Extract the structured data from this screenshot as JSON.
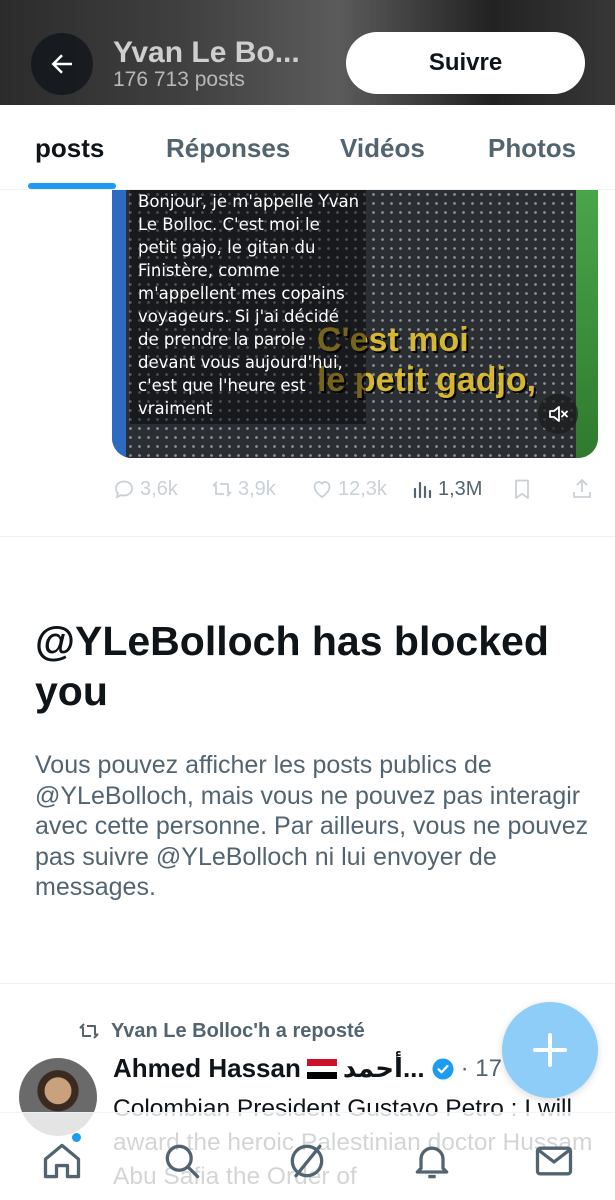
{
  "header": {
    "name": "Yvan Le Bo...",
    "post_count": "176 713 posts",
    "follow_label": "Suivre"
  },
  "tabs": [
    {
      "label": "posts",
      "active": true
    },
    {
      "label": "Réponses",
      "active": false
    },
    {
      "label": "Vidéos",
      "active": false
    },
    {
      "label": "Photos",
      "active": false
    }
  ],
  "video": {
    "caption": "Bonjour, je m'appelle Yvan Le Bolloc. C'est moi le petit gajo, le gitan du Finistère, comme m'appellent mes copains voyageurs. Si j'ai décidé de prendre la parole devant vous aujourd'hui, c'est que l'heure est vraiment",
    "overlay_line1": "C'est moi",
    "overlay_line2": "le petit gadjo,"
  },
  "actions": {
    "replies": "3,6k",
    "reposts": "3,9k",
    "likes": "12,3k",
    "views": "1,3M"
  },
  "blocked": {
    "title": "@YLeBolloch has blocked you",
    "body": "Vous pouvez afficher les posts publics de @YLeBolloch, mais vous ne pouvez pas interagir avec cette personne. Par ailleurs, vous ne pouvez pas suivre @YLeBolloch ni lui envoyer de messages."
  },
  "repost": {
    "label": "Yvan Le Bolloc'h a reposté",
    "author_name": "Ahmed Hassan",
    "author_arabic": "أحمد...",
    "time": "· 17 h",
    "more": "···",
    "text": "Colombian President Gustavo Petro : I will award the heroic Palestinian doctor Hussam Abu Safia the Order of"
  },
  "colors": {
    "accent": "#1d9bf0",
    "fab": "#8ecdf8",
    "secondary_text": "#536471",
    "primary_text": "#0f1419"
  },
  "icons": [
    "back-arrow-icon",
    "reply-icon",
    "repost-icon",
    "like-icon",
    "views-icon",
    "bookmark-icon",
    "share-icon",
    "mute-icon",
    "verified-icon",
    "plus-icon",
    "home-icon",
    "search-icon",
    "grok-icon",
    "notifications-icon",
    "messages-icon"
  ]
}
